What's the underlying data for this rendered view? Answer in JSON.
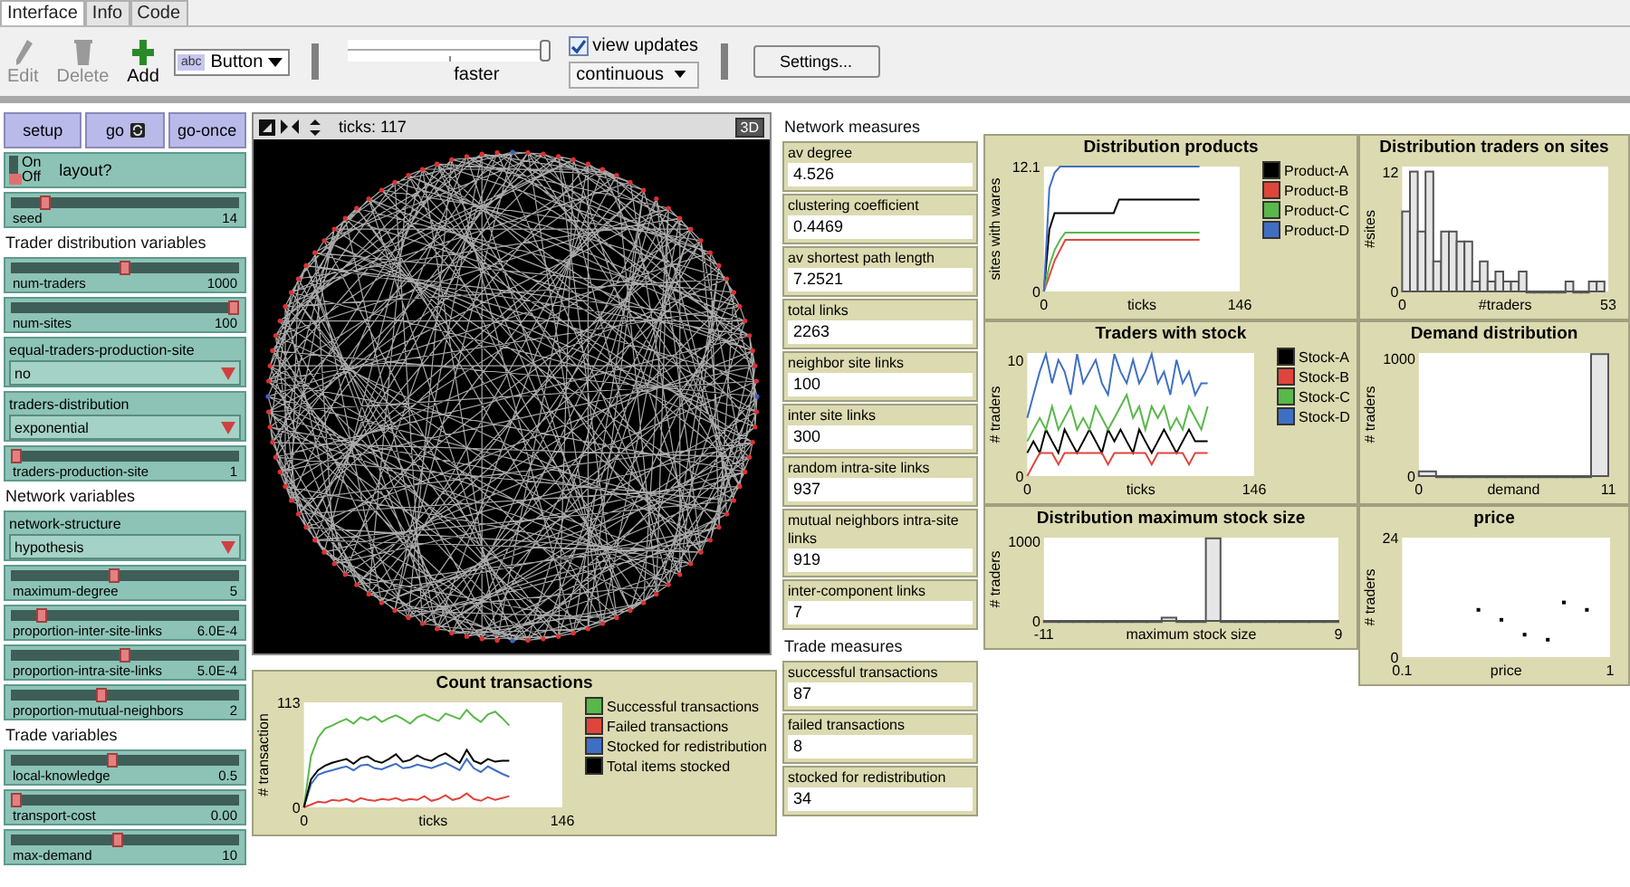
{
  "tabs": [
    {
      "label": "Interface",
      "selected": true
    },
    {
      "label": "Info",
      "selected": false
    },
    {
      "label": "Code",
      "selected": false
    }
  ],
  "toolbar": {
    "tools": [
      {
        "label": "Edit",
        "kind": "edit",
        "disabled": true
      },
      {
        "label": "Delete",
        "kind": "delete",
        "disabled": true
      },
      {
        "label": "Add",
        "kind": "add",
        "disabled": false
      }
    ],
    "widget_type": {
      "icon_text": "abc",
      "value": "Button"
    },
    "speed": {
      "label": "faster",
      "level": 1
    },
    "view_updates": {
      "label": "view updates",
      "checked": true
    },
    "update_mode": "continuous",
    "settings": "Settings..."
  },
  "widgets": [
    {
      "kind": "buttons",
      "buttons": [
        {
          "label": "setup",
          "forever": false
        },
        {
          "label": "go",
          "forever": true
        },
        {
          "label": "go-once",
          "forever": false
        }
      ]
    },
    {
      "kind": "switch",
      "label": "layout?",
      "on_label": "On",
      "off_label": "Off",
      "on": false
    },
    {
      "kind": "slider",
      "label": "seed",
      "value": "14",
      "level": 0.13
    },
    {
      "kind": "note",
      "text": "Trader distribution variables"
    },
    {
      "kind": "slider",
      "label": "num-traders",
      "value": "1000",
      "level": 0.5
    },
    {
      "kind": "slider",
      "label": "num-sites",
      "value": "100",
      "level": 1
    },
    {
      "kind": "chooser",
      "label": "equal-traders-production-site",
      "value": "no"
    },
    {
      "kind": "chooser",
      "label": "traders-distribution",
      "value": "exponential"
    },
    {
      "kind": "slider",
      "label": "traders-production-site",
      "value": "1",
      "level": 0
    },
    {
      "kind": "note",
      "text": "Network variables"
    },
    {
      "kind": "chooser",
      "label": "network-structure",
      "value": "hypothesis"
    },
    {
      "kind": "slider",
      "label": "maximum-degree",
      "value": "5",
      "level": 0.45
    },
    {
      "kind": "slider",
      "label": "proportion-inter-site-links",
      "value": "6.0E-4",
      "level": 0.12
    },
    {
      "kind": "slider",
      "label": "proportion-intra-site-links",
      "value": "5.0E-4",
      "level": 0.5
    },
    {
      "kind": "slider",
      "label": "proportion-mutual-neighbors",
      "value": "2",
      "level": 0.39
    },
    {
      "kind": "note",
      "text": "Trade variables"
    },
    {
      "kind": "slider",
      "label": "local-knowledge",
      "value": "0.5",
      "level": 0.44
    },
    {
      "kind": "slider",
      "label": "transport-cost",
      "value": "0.00",
      "level": 0
    },
    {
      "kind": "slider",
      "label": "max-demand",
      "value": "10",
      "level": 0.47
    }
  ],
  "view": {
    "ticks": "ticks: 117",
    "button_3d": "3D"
  },
  "transactions_plot": {
    "chart_data": {
      "type": "line",
      "title": "Count transactions",
      "xlabel": "ticks",
      "ylabel": "# transaction",
      "xlim": [
        0,
        146
      ],
      "ylim": [
        0,
        113
      ],
      "xticks": [
        0,
        146
      ],
      "yticks": [
        0,
        113
      ],
      "x": [
        0,
        4,
        8,
        12,
        16,
        20,
        24,
        28,
        32,
        36,
        40,
        44,
        48,
        52,
        56,
        60,
        64,
        68,
        72,
        76,
        80,
        84,
        88,
        92,
        96,
        100,
        104,
        108,
        112,
        116
      ],
      "series": [
        {
          "name": "Successful transactions",
          "color": "#59b84a",
          "values": [
            0,
            55,
            75,
            85,
            88,
            92,
            95,
            90,
            97,
            94,
            98,
            92,
            96,
            99,
            95,
            90,
            97,
            100,
            96,
            93,
            101,
            98,
            95,
            105,
            97,
            92,
            100,
            103,
            96,
            88
          ]
        },
        {
          "name": "Failed transactions",
          "color": "#e0453c",
          "values": [
            0,
            3,
            6,
            5,
            8,
            7,
            9,
            6,
            10,
            8,
            7,
            9,
            8,
            10,
            7,
            9,
            8,
            12,
            7,
            9,
            13,
            8,
            10,
            15,
            9,
            7,
            11,
            8,
            10,
            12
          ]
        },
        {
          "name": "Stocked for redistribution",
          "color": "#3f6fc4",
          "values": [
            0,
            25,
            35,
            38,
            40,
            42,
            44,
            40,
            45,
            46,
            42,
            41,
            44,
            47,
            42,
            43,
            46,
            44,
            42,
            45,
            48,
            44,
            40,
            52,
            42,
            38,
            44,
            40,
            36,
            33
          ]
        },
        {
          "name": "Total items stocked",
          "color": "#000000",
          "values": [
            0,
            30,
            40,
            45,
            48,
            50,
            52,
            47,
            53,
            55,
            50,
            48,
            52,
            57,
            49,
            51,
            56,
            52,
            50,
            55,
            58,
            53,
            48,
            62,
            50,
            47,
            52,
            49,
            50,
            50
          ]
        }
      ]
    }
  },
  "network_measures": {
    "title": "Network measures",
    "monitors": [
      {
        "label": "av degree",
        "value": "4.526"
      },
      {
        "label": "clustering coefficient",
        "value": "0.4469"
      },
      {
        "label": "av shortest path length",
        "value": "7.2521"
      },
      {
        "label": "total links",
        "value": "2263"
      },
      {
        "label": "neighbor site links",
        "value": "100"
      },
      {
        "label": "inter site links",
        "value": "300"
      },
      {
        "label": "random intra-site links",
        "value": "937"
      },
      {
        "label": "mutual neighbors intra-site links",
        "value": "919"
      },
      {
        "label": "inter-component links",
        "value": "7"
      }
    ]
  },
  "trade_measures": {
    "title": "Trade measures",
    "monitors": [
      {
        "label": "successful transactions",
        "value": "87"
      },
      {
        "label": "failed transactions",
        "value": "8"
      },
      {
        "label": "stocked for redistribution",
        "value": "34"
      }
    ]
  },
  "plots": [
    {
      "chart_data": {
        "type": "line",
        "title": "Distribution products",
        "xlabel": "ticks",
        "ylabel": "sites with wares",
        "xlim": [
          0,
          146
        ],
        "ylim": [
          0,
          12.1
        ],
        "xticks": [
          0,
          146
        ],
        "yticks": [
          0,
          12.1
        ],
        "x": [
          0,
          4,
          8,
          12,
          16,
          20,
          24,
          28,
          32,
          36,
          40,
          44,
          48,
          52,
          56,
          60,
          64,
          68,
          72,
          76,
          80,
          84,
          88,
          92,
          96,
          100,
          104,
          108,
          112,
          116
        ],
        "series": [
          {
            "name": "Product-A",
            "color": "#000000",
            "values": [
              0,
              6,
              7.6,
              7.6,
              7.6,
              7.6,
              7.6,
              7.6,
              7.6,
              7.6,
              7.6,
              7.6,
              7.6,
              7.6,
              8.9,
              8.9,
              8.9,
              8.9,
              8.9,
              8.9,
              8.9,
              8.9,
              8.9,
              8.9,
              8.9,
              8.9,
              8.9,
              8.9,
              8.9,
              8.9
            ]
          },
          {
            "name": "Product-B",
            "color": "#e0453c",
            "values": [
              0,
              1.5,
              3,
              4,
              5,
              5,
              5,
              5,
              5,
              5,
              5,
              5,
              5,
              5,
              5,
              5,
              5,
              5,
              5,
              5,
              5,
              5,
              5,
              5,
              5,
              5,
              5,
              5,
              5,
              5
            ]
          },
          {
            "name": "Product-C",
            "color": "#59b84a",
            "values": [
              0,
              2.5,
              4,
              5,
              5.7,
              5.7,
              5.7,
              5.7,
              5.7,
              5.7,
              5.7,
              5.7,
              5.7,
              5.7,
              5.7,
              5.7,
              5.7,
              5.7,
              5.7,
              5.7,
              5.7,
              5.7,
              5.7,
              5.7,
              5.7,
              5.7,
              5.7,
              5.7,
              5.7,
              5.7
            ]
          },
          {
            "name": "Product-D",
            "color": "#3f6fc4",
            "values": [
              0,
              10,
              11.5,
              12.1,
              12.1,
              12.1,
              12.1,
              12.1,
              12.1,
              12.1,
              12.1,
              12.1,
              12.1,
              12.1,
              12.1,
              12.1,
              12.1,
              12.1,
              12.1,
              12.1,
              12.1,
              12.1,
              12.1,
              12.1,
              12.1,
              12.1,
              12.1,
              12.1,
              12.1,
              12.1
            ]
          }
        ]
      }
    },
    {
      "chart_data": {
        "type": "bar",
        "title": "Distribution traders on sites",
        "xlabel": "#traders",
        "ylabel": "#sites",
        "xlim": [
          0,
          53
        ],
        "ylim": [
          0,
          12.5
        ],
        "xticks": [
          0,
          53
        ],
        "yticks": [
          0,
          12
        ],
        "x": [
          1,
          3,
          5,
          7,
          9,
          11,
          13,
          15,
          17,
          19,
          21,
          23,
          25,
          27,
          29,
          31,
          33,
          35,
          37,
          39,
          41,
          43,
          45,
          47,
          49,
          51
        ],
        "values": [
          8,
          12,
          6,
          12,
          3,
          6,
          6,
          5,
          5,
          1,
          3,
          1,
          2,
          1,
          1,
          2,
          0,
          0,
          0,
          0,
          0,
          1,
          0,
          0,
          1,
          1
        ]
      }
    },
    {
      "chart_data": {
        "type": "line",
        "title": "Traders with stock",
        "xlabel": "ticks",
        "ylabel": "# traders",
        "xlim": [
          0,
          146
        ],
        "ylim": [
          0,
          10.6
        ],
        "xticks": [
          0,
          146
        ],
        "yticks": [
          0,
          10
        ],
        "x": [
          0,
          4,
          8,
          12,
          16,
          20,
          24,
          28,
          32,
          36,
          40,
          44,
          48,
          52,
          56,
          60,
          64,
          68,
          72,
          76,
          80,
          84,
          88,
          92,
          96,
          100,
          104,
          108,
          112,
          116
        ],
        "series": [
          {
            "name": "Stock-A",
            "color": "#000000",
            "values": [
              2,
              3,
              2,
              4,
              3,
              2,
              4,
              3,
              2,
              3,
              4,
              3,
              2,
              4,
              3,
              4,
              3,
              2,
              4,
              3,
              2,
              3,
              4,
              3,
              2,
              3,
              4,
              3,
              3,
              3
            ]
          },
          {
            "name": "Stock-B",
            "color": "#e0453c",
            "values": [
              0,
              1,
              2,
              2,
              2,
              1,
              2,
              2,
              2,
              2,
              2,
              2,
              2,
              1,
              2,
              2,
              2,
              2,
              2,
              2,
              1,
              2,
              2,
              2,
              2,
              2,
              1,
              2,
              2,
              2
            ]
          },
          {
            "name": "Stock-C",
            "color": "#59b84a",
            "values": [
              3,
              4,
              5,
              4,
              6,
              4,
              5,
              6,
              4,
              5,
              4,
              6,
              5,
              4,
              5,
              6,
              7,
              5,
              6,
              4,
              6,
              5,
              6,
              4,
              5,
              4,
              6,
              5,
              4,
              6
            ]
          },
          {
            "name": "Stock-D",
            "color": "#3f6fc4",
            "values": [
              5,
              7,
              9,
              10.5,
              8,
              10,
              9,
              7,
              10.5,
              8,
              9,
              10,
              8,
              7,
              10.5,
              9,
              8,
              10,
              8,
              9,
              10.5,
              8,
              9,
              7,
              10,
              8,
              9,
              7,
              8,
              8
            ]
          }
        ]
      }
    },
    {
      "chart_data": {
        "type": "bar",
        "title": "Demand distribution",
        "xlabel": "demand",
        "ylabel": "# traders",
        "xlim": [
          0,
          11
        ],
        "ylim": [
          0,
          1050
        ],
        "xticks": [
          0,
          11
        ],
        "yticks": [
          0,
          1000
        ],
        "x": [
          0.5,
          1.5,
          2.5,
          3.5,
          4.5,
          5.5,
          6.5,
          7.5,
          8.5,
          9.5,
          10.5
        ],
        "values": [
          40,
          0,
          0,
          0,
          0,
          0,
          0,
          0,
          0,
          0,
          1040
        ]
      }
    },
    {
      "chart_data": {
        "type": "bar",
        "title": "Distribution maximum stock size",
        "xlabel": "maximum stock size",
        "ylabel": "# traders",
        "xlim": [
          -11,
          9
        ],
        "ylim": [
          0,
          1050
        ],
        "xticks": [
          -11,
          9
        ],
        "yticks": [
          0,
          1000
        ],
        "x": [
          -10.5,
          -9.5,
          -8.5,
          -7.5,
          -6.5,
          -5.5,
          -4.5,
          -3.5,
          -2.5,
          -1.5,
          -0.5,
          0.5,
          1.5,
          2.5,
          3.5,
          4.5,
          5.5,
          6.5,
          7.5,
          8.5
        ],
        "values": [
          0,
          0,
          0,
          0,
          0,
          0,
          0,
          0,
          40,
          0,
          0,
          1040,
          0,
          0,
          0,
          0,
          0,
          0,
          0,
          0
        ]
      }
    },
    {
      "chart_data": {
        "type": "scatter",
        "title": "price",
        "xlabel": "price",
        "ylabel": "# traders",
        "xlim": [
          0.1,
          1
        ],
        "ylim": [
          0,
          24
        ],
        "xticks": [
          0.1,
          1
        ],
        "yticks": [
          0,
          24
        ],
        "x": [
          0.43,
          0.53,
          0.63,
          0.73,
          0.8,
          0.9
        ],
        "values": [
          9.5,
          7.5,
          4.5,
          3.5,
          11,
          9.5
        ]
      }
    }
  ]
}
